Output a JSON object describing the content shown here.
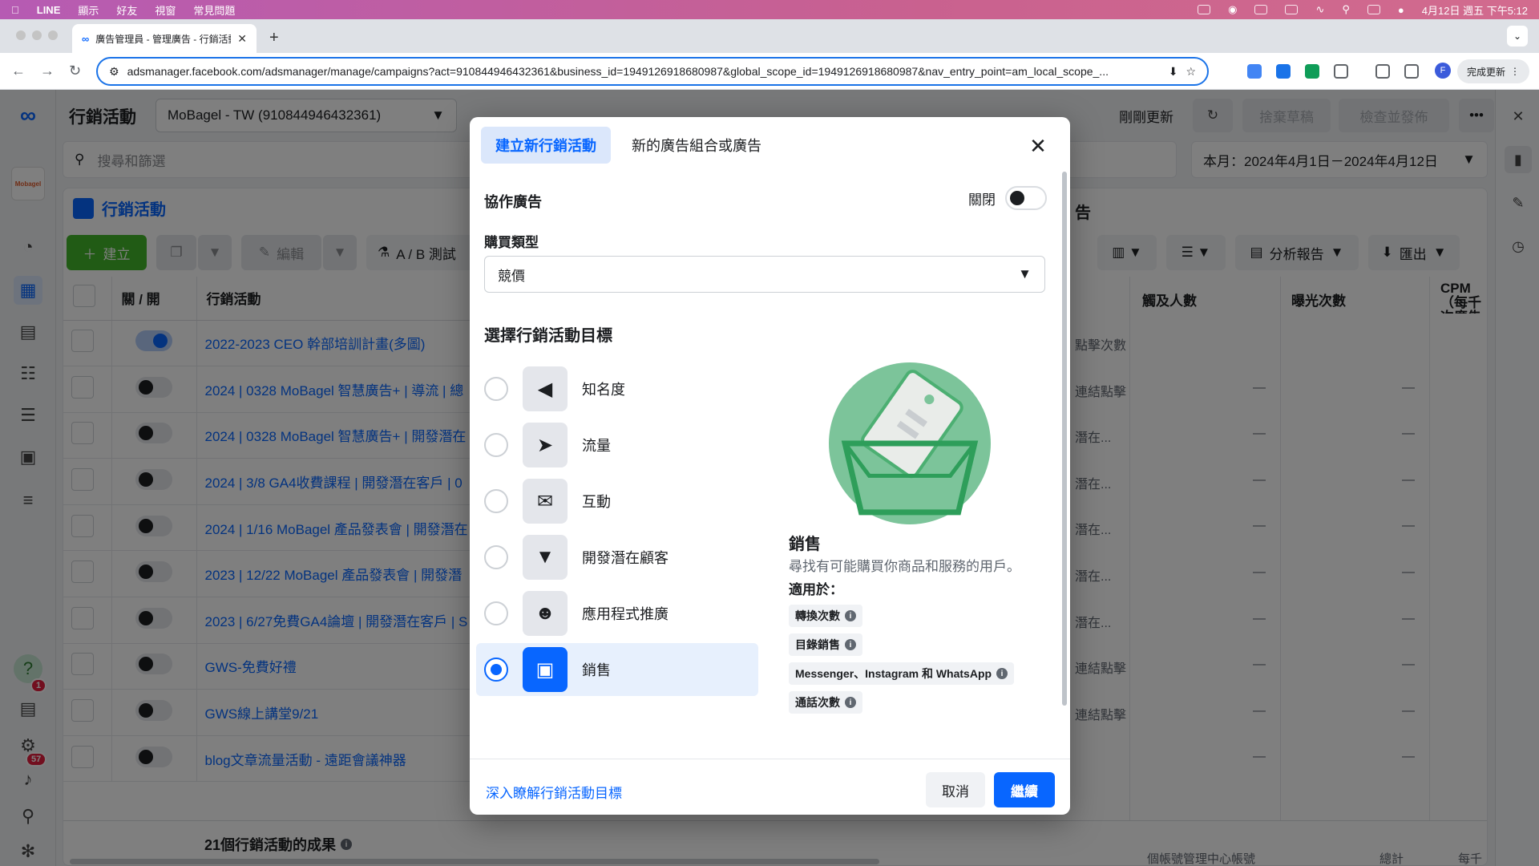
{
  "menubar": {
    "app": "LINE",
    "items": [
      "顯示",
      "好友",
      "視窗",
      "常見問題"
    ],
    "datetime": "4月12日 週五 下午5:12"
  },
  "browser": {
    "tab_title": "廣告管理員 - 管理廣告 - 行銷活動",
    "url": "adsmanager.facebook.com/adsmanager/manage/campaigns?act=910844946432361&business_id=1949126918680987&global_scope_id=1949126918680987&nav_entry_point=am_local_scope_...",
    "update_label": "完成更新",
    "profile_initial": "F"
  },
  "rail": {
    "brand": "Mobagel",
    "notif_badge": "1",
    "alerts_badge": "57"
  },
  "header": {
    "title": "行銷活動",
    "account": "MoBagel - TW (910844946432361)",
    "updated": "剛剛更新",
    "discard": "捨棄草稿",
    "review": "檢查並發佈"
  },
  "search": {
    "placeholder": "搜尋和篩選",
    "date_range": "本月：2024年4月1日－2024年4月12日"
  },
  "panel": {
    "tab": "行銷活動",
    "right_tab": "告"
  },
  "actions": {
    "create": "建立",
    "edit": "編輯",
    "ab_test": "A / B 測試",
    "reports": "分析報告",
    "export": "匯出"
  },
  "table": {
    "headers": {
      "toggle": "關 / 開",
      "campaign": "行銷活動",
      "reach": "觸及人數",
      "impressions": "曝光次數",
      "cpm": "CPM（每千次廣告曝光成本）"
    },
    "rows": [
      {
        "name": "2022-2023 CEO 幹部培訓計畫(多圖)",
        "result": "點擊次數"
      },
      {
        "name": "2024 | 0328 MoBagel 智慧廣告+ | 導流 | 總",
        "result": "連結點擊"
      },
      {
        "name": "2024 | 0328 MoBagel 智慧廣告+ | 開發潛在",
        "result": "潛在..."
      },
      {
        "name": "2024 | 3/8 GA4收費課程 | 開發潛在客戶 | 0",
        "result": "潛在..."
      },
      {
        "name": "2024 | 1/16 MoBagel 產品發表會 | 開發潛在",
        "result": "潛在..."
      },
      {
        "name": "2023 | 12/22 MoBagel 產品發表會 | 開發潛",
        "result": "潛在..."
      },
      {
        "name": "2023 | 6/27免費GA4論壇 | 開發潛在客戶 | S",
        "result": "潛在..."
      },
      {
        "name": "GWS-免費好禮",
        "result": "連結點擊"
      },
      {
        "name": "GWS線上講堂9/21",
        "result": "連結點擊"
      },
      {
        "name": "blog文章流量活動 - 遠距會議神器",
        "result": ""
      }
    ],
    "dash": "—",
    "summary": "21個行銷活動的成果",
    "summary_reach": "個帳號管理中心帳號",
    "summary_total": "總計",
    "summary_per": "每千"
  },
  "dialog": {
    "tab_new_campaign": "建立新行銷活動",
    "tab_new_adset": "新的廣告組合或廣告",
    "collab_label": "協作廣告",
    "collab_state": "關閉",
    "buying_label": "購買類型",
    "buying_value": "競價",
    "objective_title": "選擇行銷活動目標",
    "objectives": [
      {
        "label": "知名度",
        "icon": "megaphone-icon"
      },
      {
        "label": "流量",
        "icon": "cursor-icon"
      },
      {
        "label": "互動",
        "icon": "chat-bubbles-icon"
      },
      {
        "label": "開發潛在顧客",
        "icon": "funnel-icon"
      },
      {
        "label": "應用程式推廣",
        "icon": "people-icon"
      },
      {
        "label": "銷售",
        "icon": "shopping-bag-icon"
      }
    ],
    "selected_objective": "銷售",
    "detail_title": "銷售",
    "detail_text": "尋找有可能購買你商品和服務的用戶。",
    "detail_sub": "適用於：",
    "chips": [
      "轉換次數",
      "目錄銷售",
      "Messenger、Instagram 和 WhatsApp",
      "通話次數"
    ],
    "learn_more": "深入瞭解行銷活動目標",
    "cancel": "取消",
    "continue": "繼續"
  },
  "colors": {
    "accent": "#0866ff",
    "green": "#42b72a",
    "illustration": "#7cc49a"
  }
}
